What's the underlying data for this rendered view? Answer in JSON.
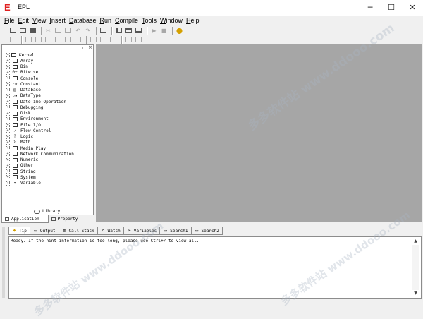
{
  "window": {
    "title": "EPL",
    "logo_letter": "E",
    "controls": {
      "minimize": "─",
      "maximize": "☐",
      "close": "✕"
    }
  },
  "menu": [
    {
      "label": "File",
      "key": "F",
      "rest": "ile"
    },
    {
      "label": "Edit",
      "key": "E",
      "rest": "dit"
    },
    {
      "label": "View",
      "key": "V",
      "rest": "iew"
    },
    {
      "label": "Insert",
      "key": "I",
      "rest": "nsert"
    },
    {
      "label": "Database",
      "key": "D",
      "rest": "atabase"
    },
    {
      "label": "Run",
      "key": "R",
      "rest": "un"
    },
    {
      "label": "Compile",
      "key": "C",
      "rest": "ompile"
    },
    {
      "label": "Tools",
      "key": "T",
      "rest": "ools"
    },
    {
      "label": "Window",
      "key": "W",
      "rest": "indow"
    },
    {
      "label": "Help",
      "key": "H",
      "rest": "elp"
    }
  ],
  "library_tree": {
    "root": "Kernel",
    "items": [
      {
        "label": "Array",
        "icon": "library-icon"
      },
      {
        "label": "Bin",
        "icon": "library-icon"
      },
      {
        "label": "Bitwise",
        "icon": "bitwise-icon"
      },
      {
        "label": "Console",
        "icon": "library-icon"
      },
      {
        "label": "Constant",
        "icon": "constant-icon"
      },
      {
        "label": "Database",
        "icon": "database-icon"
      },
      {
        "label": "DataType",
        "icon": "datatype-icon"
      },
      {
        "label": "DateTime Operation",
        "icon": "library-icon"
      },
      {
        "label": "Debugging",
        "icon": "library-icon"
      },
      {
        "label": "Disk",
        "icon": "library-icon"
      },
      {
        "label": "Environment",
        "icon": "library-icon"
      },
      {
        "label": "File I/O",
        "icon": "library-icon"
      },
      {
        "label": "Flow Control",
        "icon": "flow-icon"
      },
      {
        "label": "Logic",
        "icon": "logic-icon"
      },
      {
        "label": "Math",
        "icon": "math-icon"
      },
      {
        "label": "Media Play",
        "icon": "library-icon"
      },
      {
        "label": "Network Communication",
        "icon": "library-icon"
      },
      {
        "label": "Numeric",
        "icon": "library-icon"
      },
      {
        "label": "Other",
        "icon": "library-icon"
      },
      {
        "label": "String",
        "icon": "library-icon"
      },
      {
        "label": "System",
        "icon": "library-icon"
      },
      {
        "label": "Variable",
        "icon": "variable-icon"
      }
    ],
    "footer_label": "Library"
  },
  "left_tabs": [
    {
      "label": "Application",
      "active": true
    },
    {
      "label": "Property",
      "active": false
    }
  ],
  "bottom_tabs": [
    {
      "label": "Tip",
      "icon": "tip-icon"
    },
    {
      "label": "Output",
      "icon": "output-icon"
    },
    {
      "label": "Call Stack",
      "icon": "call-stack-icon"
    },
    {
      "label": "Watch",
      "icon": "watch-icon"
    },
    {
      "label": "Variables",
      "icon": "variables-icon"
    },
    {
      "label": "Search1",
      "icon": "search-icon"
    },
    {
      "label": "Search2",
      "icon": "search-icon"
    }
  ],
  "status_message": "Ready. If the hint information is too long, please use Ctrl+/ to view all.",
  "watermark": "多多软件站 www.ddooo.com",
  "colors": {
    "workspace": "#a6a6a6",
    "logo": "#e02020"
  }
}
